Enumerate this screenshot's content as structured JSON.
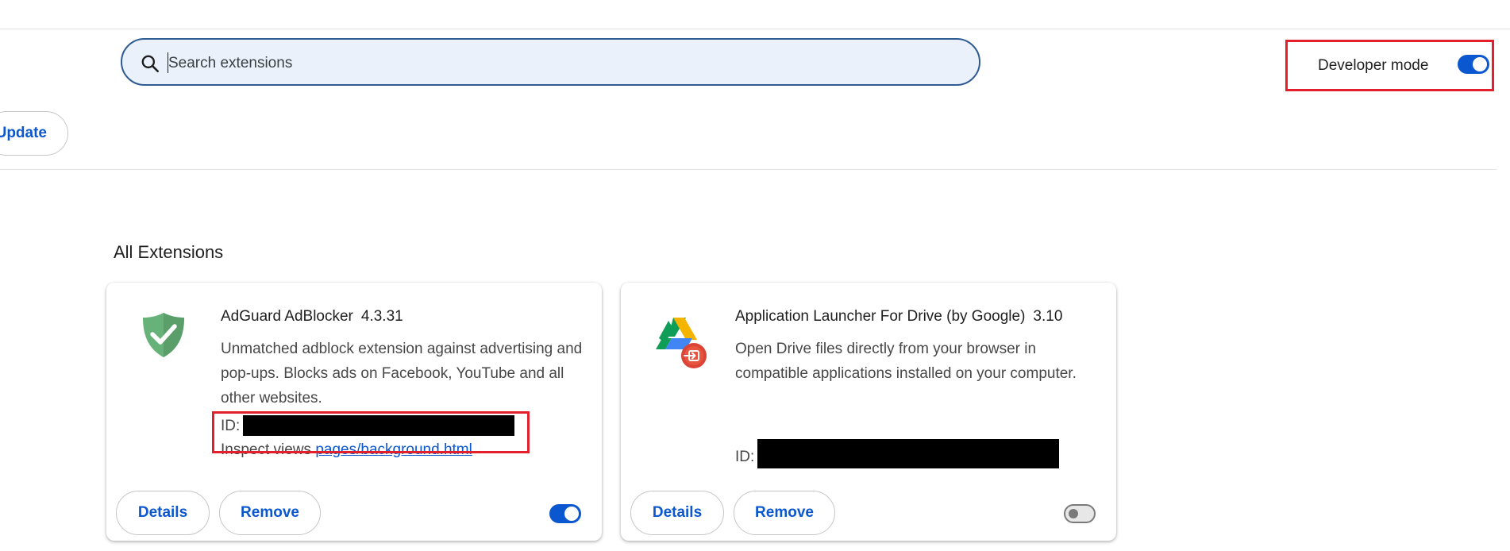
{
  "search": {
    "placeholder": "Search extensions"
  },
  "toolbar": {
    "developer_mode_label": "Developer mode",
    "developer_mode_on": true,
    "update_label": "Update"
  },
  "section": {
    "title": "All Extensions"
  },
  "extensions": [
    {
      "name": "AdGuard AdBlocker",
      "version": "4.3.31",
      "description": "Unmatched adblock extension against advertising and pop-ups. Blocks ads on Facebook, YouTube and all other websites.",
      "id_label": "ID:",
      "inspect_label": "Inspect views",
      "inspect_link": "pages/background.html",
      "details_label": "Details",
      "remove_label": "Remove",
      "enabled": true,
      "icon": "adguard-shield-icon"
    },
    {
      "name": "Application Launcher For Drive (by Google)",
      "version": "3.10",
      "description": "Open Drive files directly from your browser in compatible applications installed on your computer.",
      "id_label": "ID:",
      "details_label": "Details",
      "remove_label": "Remove",
      "enabled": false,
      "icon": "google-drive-launcher-icon"
    }
  ],
  "colors": {
    "accent": "#0b57d0",
    "highlight": "#e21f2a",
    "search_bg": "#eaf1fb"
  }
}
